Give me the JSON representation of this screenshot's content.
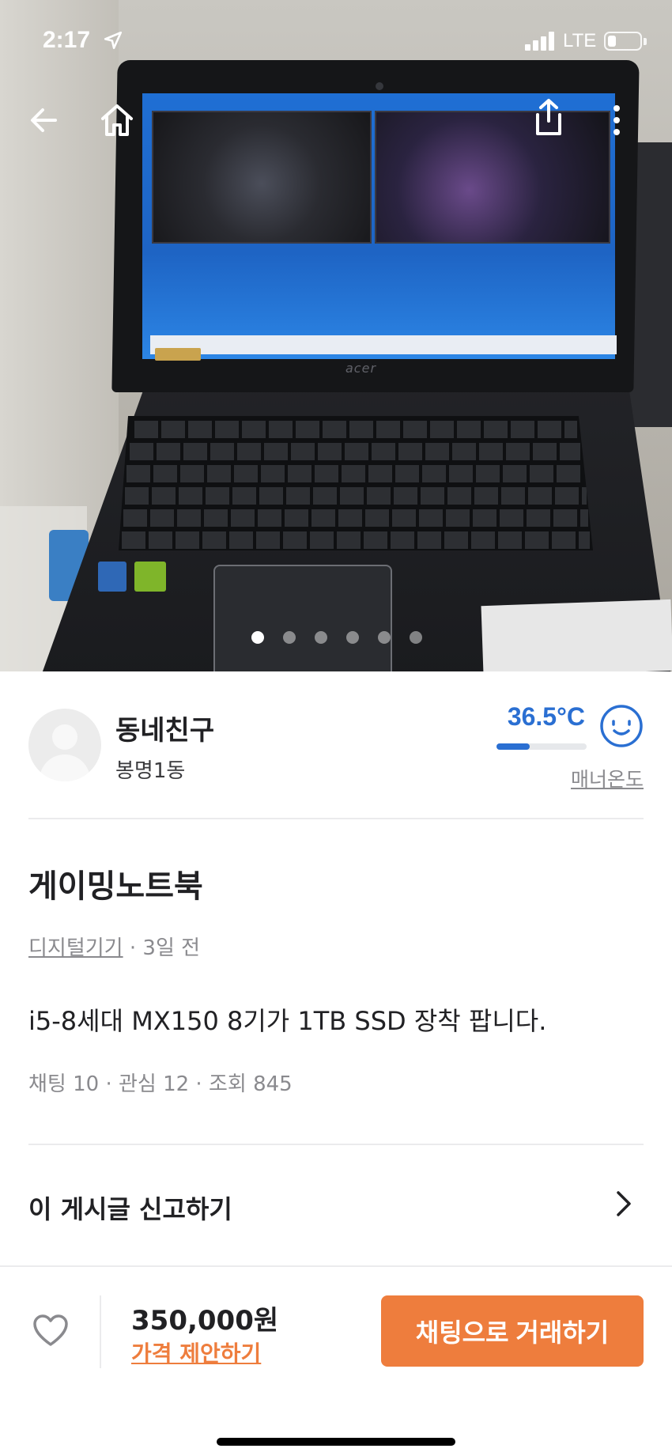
{
  "status_bar": {
    "time": "2:17",
    "network": "LTE",
    "signal_bars": 4,
    "battery_level": 0.25
  },
  "top_nav": {
    "icons": [
      "back-arrow-icon",
      "home-icon",
      "share-icon",
      "more-vertical-icon"
    ]
  },
  "carousel": {
    "total_images": 6,
    "active_index": 0
  },
  "photo": {
    "laptop_brand": "acer"
  },
  "seller": {
    "name": "동네친구",
    "location": "봉명1동",
    "temperature": "36.5°C",
    "temperature_fraction": 0.365,
    "manner_label": "매너온도",
    "accent_color": "#2a6fd2"
  },
  "post": {
    "title": "게이밍노트북",
    "category": "디지털기기",
    "time_ago": "· 3일 전",
    "body": "i5-8세대 MX150 8기가 1TB SSD 장착 팝니다.",
    "stats": "채팅 10 · 관심 12 · 조회 845"
  },
  "report": {
    "label": "이 게시글 신고하기"
  },
  "bottom_bar": {
    "price": "350,000원",
    "offer_label": "가격 제안하기",
    "chat_button_label": "채팅으로 거래하기",
    "accent_color": "#ee7d3d"
  }
}
